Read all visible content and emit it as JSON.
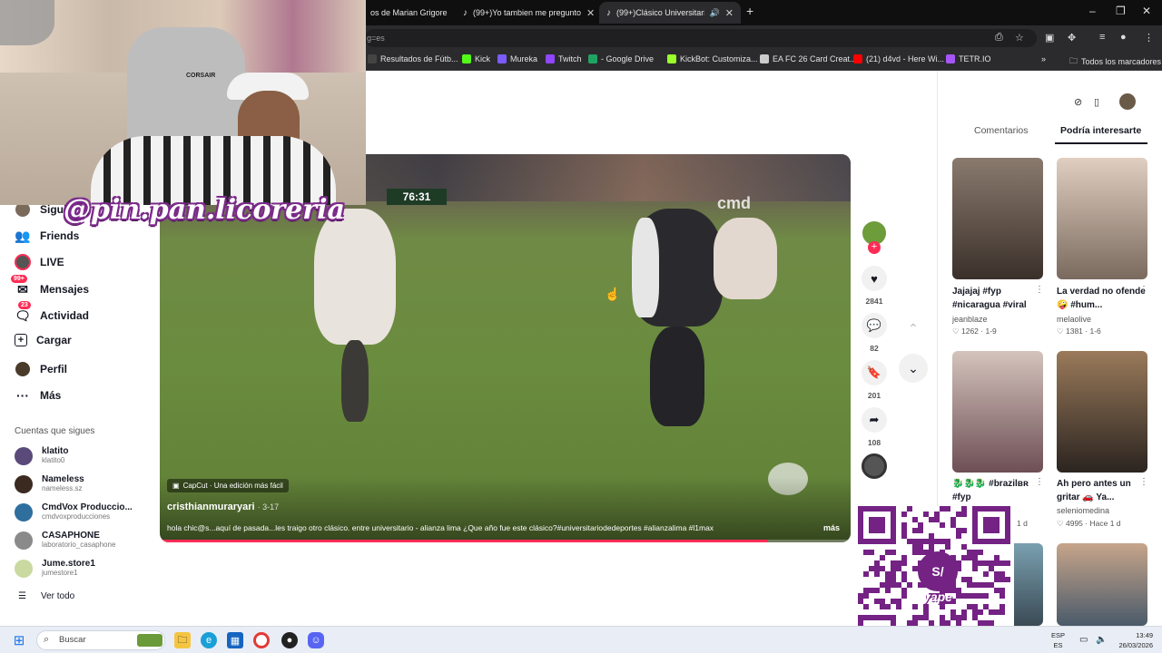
{
  "browser": {
    "tabs": [
      {
        "label": "os de Marian Grigore",
        "active": false
      },
      {
        "label": "(99+)Yo tambien me pregunto",
        "active": false
      },
      {
        "label": "(99+)Clásico Universitario",
        "active": true
      }
    ],
    "new_tab": "+",
    "window_controls": [
      "–",
      "❐",
      "✕"
    ],
    "address": "g=es",
    "bookmarks": [
      {
        "label": "Resultados de Fútb...",
        "color": "#444444"
      },
      {
        "label": "Kick",
        "color": "#53fc18"
      },
      {
        "label": "Mureka",
        "color": "#7b5cff"
      },
      {
        "label": "Twitch",
        "color": "#9146ff"
      },
      {
        "label": "- Google Drive",
        "color": "#1fa463"
      },
      {
        "label": "KickBot: Customiza...",
        "color": "#9aff2a"
      },
      {
        "label": "EA FC 26 Card Creat...",
        "color": "#cccccc"
      },
      {
        "label": "(21) d4vd - Here Wi...",
        "color": "#ff0000"
      },
      {
        "label": "TETR.IO",
        "color": "#a855f7"
      }
    ],
    "bookmarks_more": "»",
    "all_bookmarks": "Todos los marcadores"
  },
  "sidebar": {
    "items": [
      {
        "label": "Siguie",
        "icon": "following-icon",
        "badge": ""
      },
      {
        "label": "Friends",
        "icon": "friends-icon",
        "badge": ""
      },
      {
        "label": "LIVE",
        "icon": "live-icon",
        "badge": ""
      },
      {
        "label": "Mensajes",
        "icon": "messages-icon",
        "badge": "99+"
      },
      {
        "label": "Actividad",
        "icon": "activity-icon",
        "badge": "23"
      },
      {
        "label": "Cargar",
        "icon": "upload-icon",
        "badge": ""
      },
      {
        "label": "Perfil",
        "icon": "profile-icon",
        "badge": ""
      },
      {
        "label": "Más",
        "icon": "more-icon",
        "badge": ""
      }
    ],
    "following_header": "Cuentas que sigues",
    "accounts": [
      {
        "name": "klatito",
        "handle": "klatito0",
        "color": "#5a4a7a"
      },
      {
        "name": "Nameless",
        "handle": "nameless.sz",
        "color": "#3a2a20"
      },
      {
        "name": "CmdVox Produccio...",
        "handle": "cmdvoxproducciones",
        "color": "#2e6f9e"
      },
      {
        "name": "CASAPHONE",
        "handle": "laboratorio_casaphone",
        "color": "#8a8a8a"
      },
      {
        "name": "Jume.store1",
        "handle": "jumestore1",
        "color": "#c9d9a0"
      }
    ],
    "see_all": "Ver todo"
  },
  "video": {
    "score_overlay": "76:31",
    "sponsor_overlay": "cmd",
    "capcut_label": "CapCut · Una edición más fácil",
    "author": "cristhianmuraryari",
    "date": "· 3-17",
    "description": "hola chic@s...aquí de pasada...les traigo otro clásico. entre universitario - alianza lima ¿Que año fue este clásico?#universitariodedeportes #alianzalima #l1max",
    "more_label": "más",
    "progress": 0.88
  },
  "actions": {
    "likes": "2841",
    "comments": "82",
    "saves": "201",
    "shares": "108"
  },
  "right_panel": {
    "tabs": [
      {
        "label": "Comentarios",
        "active": false
      },
      {
        "label": "Podría interesarte",
        "active": true
      }
    ],
    "cards": [
      {
        "title": "Jajajaj #fyp #nicaragua #viral",
        "user": "jeanblaze",
        "likes": "1262",
        "date": "1-9",
        "thumb_a": "#6e5b4e",
        "thumb_b": "#2f2a26"
      },
      {
        "title": "La verdad no ofende 🤪 #hum...",
        "user": "melaolive",
        "likes": "1381",
        "date": "1-6",
        "thumb_a": "#d9c7b8",
        "thumb_b": "#7a6a5e"
      },
      {
        "title": "🐉🐉🐉 #brazilʙʀ #fyp",
        "user": "",
        "likes": "",
        "date": "",
        "thumb_a": "#c9b8b0",
        "thumb_b": "#6d4f55"
      },
      {
        "title": "Ah pero antes un gritar 🚗 Ya...",
        "user": "seleniomedina",
        "likes": "4995",
        "date": "Hace 1 d",
        "thumb_a": "#8a6a4a",
        "thumb_b": "#2b2420"
      },
      {
        "title": "",
        "user": "",
        "likes": "",
        "date": "1 d",
        "thumb_a": "#7aa0b0",
        "thumb_b": "#3a4a55"
      },
      {
        "title": "",
        "user": "",
        "likes": "",
        "date": "",
        "thumb_a": "#c7a58a",
        "thumb_b": "#4a5a6a"
      }
    ]
  },
  "overlay": {
    "handle": "@pin.pan.licoreria",
    "qr_brand": "yape",
    "qr_symbol": "S/"
  },
  "taskbar": {
    "search_placeholder": "Buscar",
    "lang": "ESP",
    "lang_sub": "ES",
    "time": "13:49",
    "date": "26/03/2026"
  }
}
